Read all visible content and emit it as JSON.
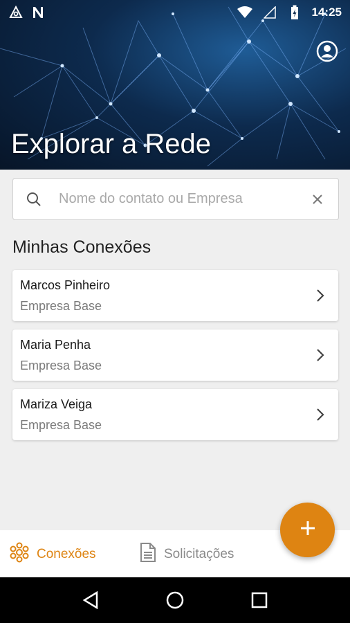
{
  "status_bar": {
    "time": "14:25",
    "icons": [
      "app-triangle-icon",
      "n-notification-icon",
      "wifi-icon",
      "cellular-icon",
      "battery-charging-icon"
    ]
  },
  "header": {
    "title": "Explorar a Rede",
    "profile_icon": "account-circle-icon"
  },
  "search": {
    "placeholder": "Nome do contato ou Empresa",
    "value": ""
  },
  "section": {
    "title": "Minhas Conexões"
  },
  "connections": [
    {
      "name": "Marcos Pinheiro",
      "company": "Empresa Base"
    },
    {
      "name": "Maria Penha",
      "company": "Empresa Base"
    },
    {
      "name": "Mariza Veiga",
      "company": "Empresa Base"
    }
  ],
  "fab": {
    "icon": "plus-icon"
  },
  "bottom_nav": {
    "items": [
      {
        "label": "Conexões",
        "icon": "connections-icon",
        "active": true
      },
      {
        "label": "Solicitações",
        "icon": "document-icon",
        "active": false
      }
    ]
  },
  "colors": {
    "accent": "#de8412",
    "inactive": "#8a8a8a",
    "background": "#efefef"
  }
}
